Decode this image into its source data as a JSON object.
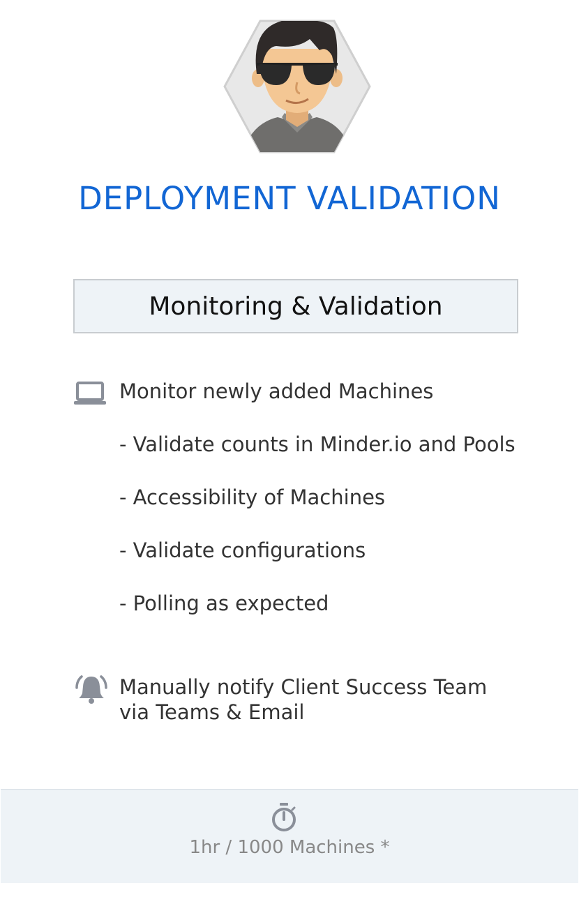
{
  "header": {
    "title": "DEPLOYMENT VALIDATION"
  },
  "section": {
    "heading": "Monitoring & Validation"
  },
  "monitor": {
    "icon": "laptop-icon",
    "label": "Monitor newly added Machines",
    "subitems": [
      "- Validate counts in Minder.io and Pools",
      "- Accessibility of Machines",
      "- Validate configurations",
      "- Polling as expected"
    ]
  },
  "notify": {
    "icon": "bell-ringing-icon",
    "line1": "Manually notify Client Success Team",
    "line2": "via Teams & Email"
  },
  "footer": {
    "icon": "stopwatch-icon",
    "text": "1hr / 1000 Machines *"
  },
  "colors": {
    "title": "#1266d4",
    "box_bg": "#eef3f7",
    "icon": "#8a8f99"
  }
}
